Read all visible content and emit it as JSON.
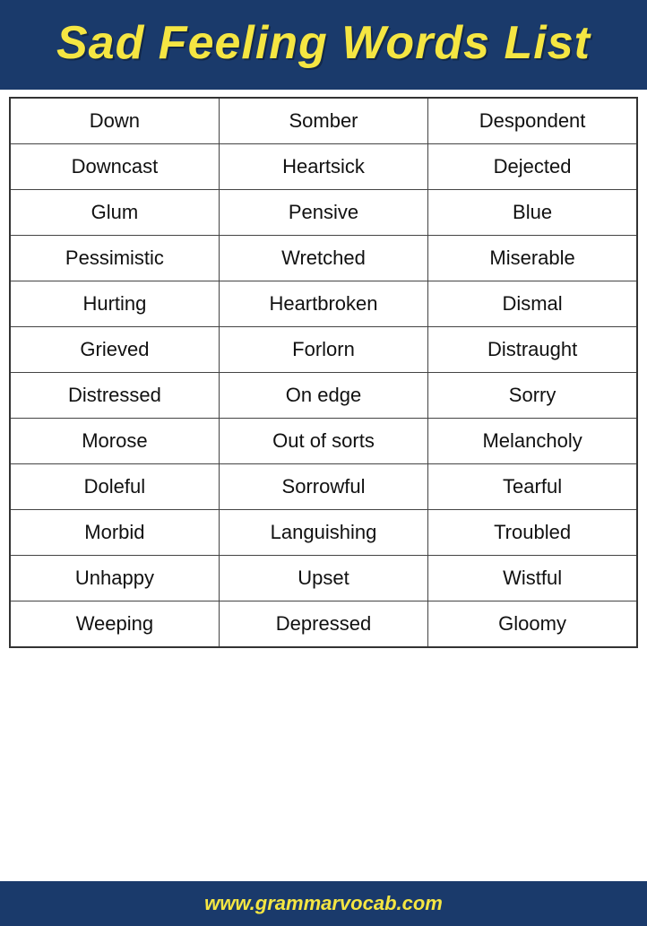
{
  "header": {
    "title": "Sad Feeling Words List"
  },
  "table": {
    "rows": [
      [
        "Down",
        "Somber",
        "Despondent"
      ],
      [
        "Downcast",
        "Heartsick",
        "Dejected"
      ],
      [
        "Glum",
        "Pensive",
        "Blue"
      ],
      [
        "Pessimistic",
        "Wretched",
        "Miserable"
      ],
      [
        "Hurting",
        "Heartbroken",
        "Dismal"
      ],
      [
        "Grieved",
        "Forlorn",
        "Distraught"
      ],
      [
        "Distressed",
        "On edge",
        "Sorry"
      ],
      [
        "Morose",
        "Out of sorts",
        "Melancholy"
      ],
      [
        "Doleful",
        "Sorrowful",
        "Tearful"
      ],
      [
        "Morbid",
        "Languishing",
        "Troubled"
      ],
      [
        "Unhappy",
        "Upset",
        "Wistful"
      ],
      [
        "Weeping",
        "Depressed",
        "Gloomy"
      ]
    ]
  },
  "footer": {
    "text": "www.grammarvocab.com"
  }
}
